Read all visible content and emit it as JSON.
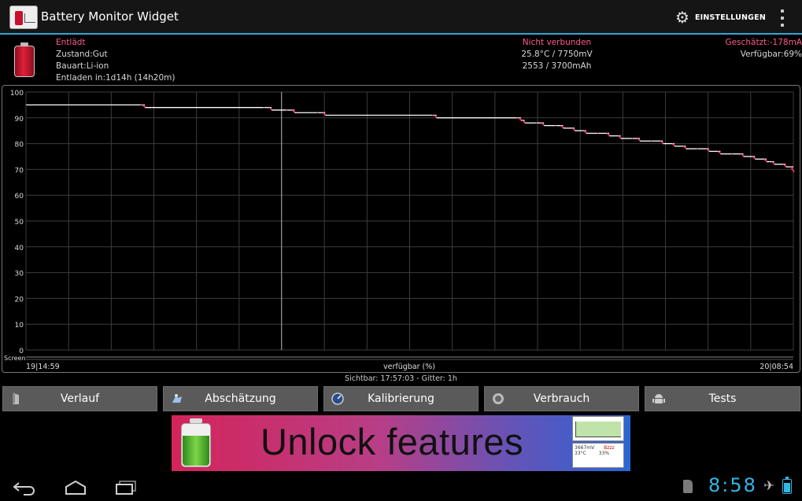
{
  "app": {
    "title": "Battery Monitor Widget",
    "settings_label": "EINSTELLUNGEN",
    "icon": "battery-monitor-app-icon"
  },
  "info": {
    "status": "Entlädt",
    "condition": "Zustand:Gut",
    "type": "Bauart:Li-ion",
    "charge_time": "Entladen in:1d14h (14h20m)",
    "connection": "Nicht verbunden",
    "temp_voltage": "25.8°C / 7750mV",
    "capacity": "2553 / 3700mAh",
    "estimated": "Geschätzt:-178mA",
    "available": "Verfügbar:69%"
  },
  "chart_data": {
    "type": "line",
    "y_ticks": [
      "100",
      "90",
      "80",
      "70",
      "60",
      "50",
      "40",
      "30",
      "20",
      "10",
      "0"
    ],
    "ylim": [
      0,
      100
    ],
    "grid": true,
    "x_start_label": "19|14:59",
    "x_end_label": "20|08:54",
    "xlabel": "verfügbar (%)",
    "screen_label": "Screen",
    "x": [
      0.0,
      0.15,
      0.155,
      0.31,
      0.32,
      0.34,
      0.35,
      0.38,
      0.39,
      0.53,
      0.535,
      0.64,
      0.645,
      0.65,
      0.665,
      0.675,
      0.69,
      0.7,
      0.715,
      0.73,
      0.745,
      0.76,
      0.775,
      0.79,
      0.8,
      0.815,
      0.83,
      0.845,
      0.86,
      0.875,
      0.89,
      0.905,
      0.92,
      0.935,
      0.95,
      0.965,
      0.975,
      0.99,
      1.0
    ],
    "values": [
      95,
      95,
      94,
      94,
      93,
      93,
      92,
      92,
      91,
      91,
      90,
      90,
      89,
      88,
      88,
      87,
      87,
      86,
      85,
      84,
      84,
      83,
      82,
      82,
      81,
      81,
      80,
      79,
      78,
      78,
      77,
      76,
      76,
      75,
      74,
      73,
      72,
      71,
      69
    ],
    "cursor_x": 0.333
  },
  "footer": {
    "visible_info": "Sichtbar: 17:57:03 - Gitter: 1h"
  },
  "buttons": [
    {
      "label": "Verlauf",
      "icon": "history-icon"
    },
    {
      "label": "Abschätzung",
      "icon": "estimate-icon"
    },
    {
      "label": "Kalibrierung",
      "icon": "calibration-icon"
    },
    {
      "label": "Verbrauch",
      "icon": "usage-icon"
    },
    {
      "label": "Tests",
      "icon": "android-icon"
    }
  ],
  "ad": {
    "headline": "Unlock features",
    "thumb_text_1": "3667mV",
    "thumb_text_2": "Bzzz",
    "thumb_text_3": "33°C",
    "thumb_text_4": "33%"
  },
  "statusbar": {
    "clock": "8:58"
  },
  "colors": {
    "accent": "#33a5d7",
    "pink": "#ff5a8a",
    "line": "#ffffff",
    "line_step": "#ff3b6a"
  }
}
